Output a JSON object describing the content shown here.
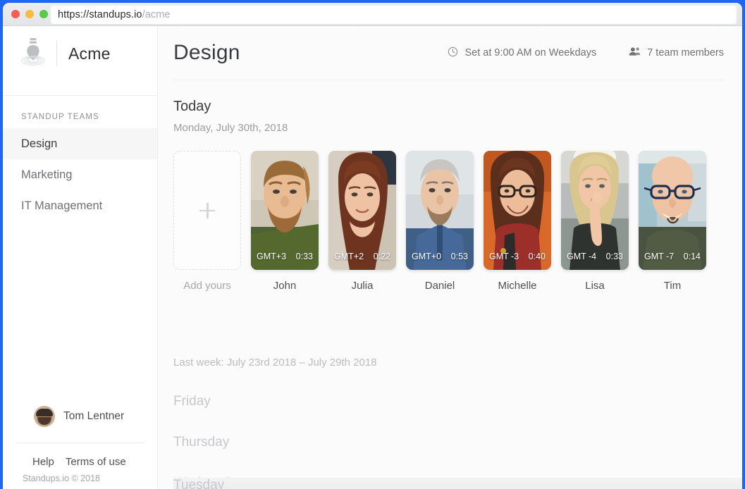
{
  "browser": {
    "url_base": "https://standups.io",
    "url_path": "/acme",
    "traffic_lights": [
      "close-red",
      "minimize-yellow",
      "maximize-green"
    ]
  },
  "sidebar": {
    "logo_icon": "standups-ripple-logo-icon",
    "brand": "Acme",
    "heading": "STANDUP TEAMS",
    "items": [
      {
        "label": "Design",
        "active": true
      },
      {
        "label": "Marketing",
        "active": false
      },
      {
        "label": "IT Management",
        "active": false
      }
    ],
    "user": {
      "name": "Tom Lentner",
      "avatar_icon": "user-avatar"
    },
    "links": [
      "Help",
      "Terms of use"
    ],
    "copyright": "Standups.io © 2018"
  },
  "header": {
    "title": "Design",
    "schedule": {
      "icon": "clock-icon",
      "label": "Set at 9:00 AM on Weekdays"
    },
    "members": {
      "icon": "people-icon",
      "label": "7 team members"
    }
  },
  "today": {
    "title": "Today",
    "date": "Monday, July 30th, 2018",
    "add_tile": {
      "label": "Add yours",
      "icon": "plus-icon"
    },
    "entries": [
      {
        "name": "John",
        "timezone": "GMT+3",
        "duration": "0:33"
      },
      {
        "name": "Julia",
        "timezone": "GMT+2",
        "duration": "0:22"
      },
      {
        "name": "Daniel",
        "timezone": "GMT+0",
        "duration": "0:53"
      },
      {
        "name": "Michelle",
        "timezone": "GMT -3",
        "duration": "0:40"
      },
      {
        "name": "Lisa",
        "timezone": "GMT -4",
        "duration": "0:33"
      },
      {
        "name": "Tim",
        "timezone": "GMT -7",
        "duration": "0:14"
      }
    ]
  },
  "last_week": {
    "label": "Last week: July 23rd 2018 – July 29th 2018",
    "days": [
      "Friday",
      "Thursday",
      "Wednesday"
    ],
    "partial_day": "Tuesday"
  },
  "colors": {
    "window_border": "#1f66f5",
    "sidebar_bg": "#ffffff",
    "main_bg": "#fbfbfb",
    "active_item_bg": "#f6f6f7",
    "text_primary": "#3b3c3f",
    "text_muted": "#9b9da1"
  }
}
